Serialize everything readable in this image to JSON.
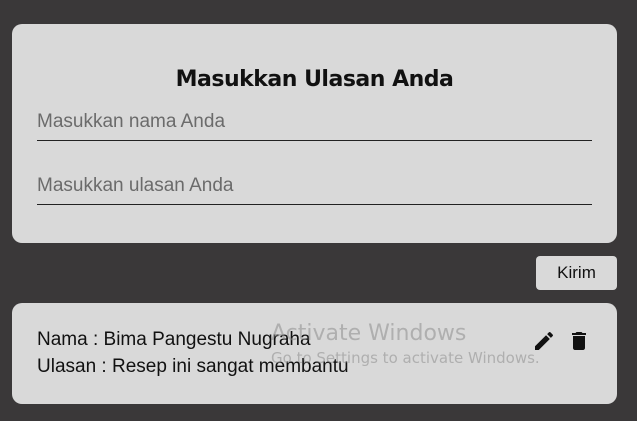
{
  "form": {
    "title": "Masukkan Ulasan Anda",
    "name_placeholder": "Masukkan nama Anda",
    "name_value": "",
    "review_placeholder": "Masukkan ulasan Anda",
    "review_value": "",
    "submit_label": "Kirim"
  },
  "reviews": [
    {
      "name_line": "Nama : Bima Pangestu Nugraha",
      "review_line": "Ulasan : Resep ini sangat membantu",
      "edit_icon": "pencil-icon",
      "delete_icon": "trash-icon"
    }
  ],
  "watermark": {
    "title": "Activate Windows",
    "subtitle": "Go to Settings to activate Windows."
  },
  "colors": {
    "background": "#3a3839",
    "card": "#d9d9d9",
    "text": "#111111"
  }
}
